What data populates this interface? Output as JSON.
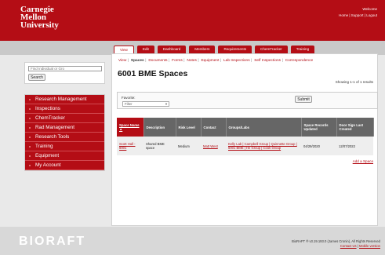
{
  "header": {
    "logo_lines": [
      "Carnegie",
      "Mellon",
      "University"
    ],
    "welcome": "Welcome",
    "links": [
      "Home",
      "Support",
      "Logout"
    ]
  },
  "tabs": [
    "View",
    "Edit",
    "Dashboard",
    "Members",
    "Requirements",
    "ChemTracker",
    "Training"
  ],
  "subnav": [
    "View",
    "Spaces",
    "Documents",
    "Forms",
    "Notes",
    "Equipment",
    "Lab Inspections",
    "Self Inspections",
    "Correspondence"
  ],
  "page": {
    "title": "6001 BME Spaces",
    "showing": "Showing 1-1 of 1 results"
  },
  "filter": {
    "label": "Favorite:",
    "select_value": "Filter",
    "submit_label": "Submit"
  },
  "table": {
    "headers": [
      "Space Name ▲",
      "Description",
      "Risk Level",
      "Contact",
      "Groups/Labs",
      "Space Records Updated",
      "Door Sign Last Created"
    ],
    "rows": [
      {
        "space_name": "Scott Hall - 6001",
        "description": "Shared BME space",
        "risk_level": "Medium",
        "contact": "Matt West",
        "groups": "Kelly Lab | Campbell Group | Quinnette Group | 6001 BME | He Group | Cook Group",
        "records_updated": "04/29/2020",
        "door_sign": "12/07/2022"
      }
    ],
    "add_link": "Add a Space"
  },
  "sidebar": {
    "search_placeholder": "Find Individual or Gro",
    "search_button": "Search",
    "items": [
      "Research Management",
      "Inspections",
      "ChemTracker",
      "Rad Management",
      "Research Tools",
      "Training",
      "Equipment",
      "My Account"
    ]
  },
  "footer": {
    "brand": "BIORAFT",
    "copyright": "BioRAFT ® v3.19.193.0 (James Cronin), All Rights Reserved",
    "links": [
      "Contact Us",
      "Mobile version"
    ]
  },
  "colors": {
    "brand_red": "#b40d15",
    "header_gray": "#666666"
  }
}
